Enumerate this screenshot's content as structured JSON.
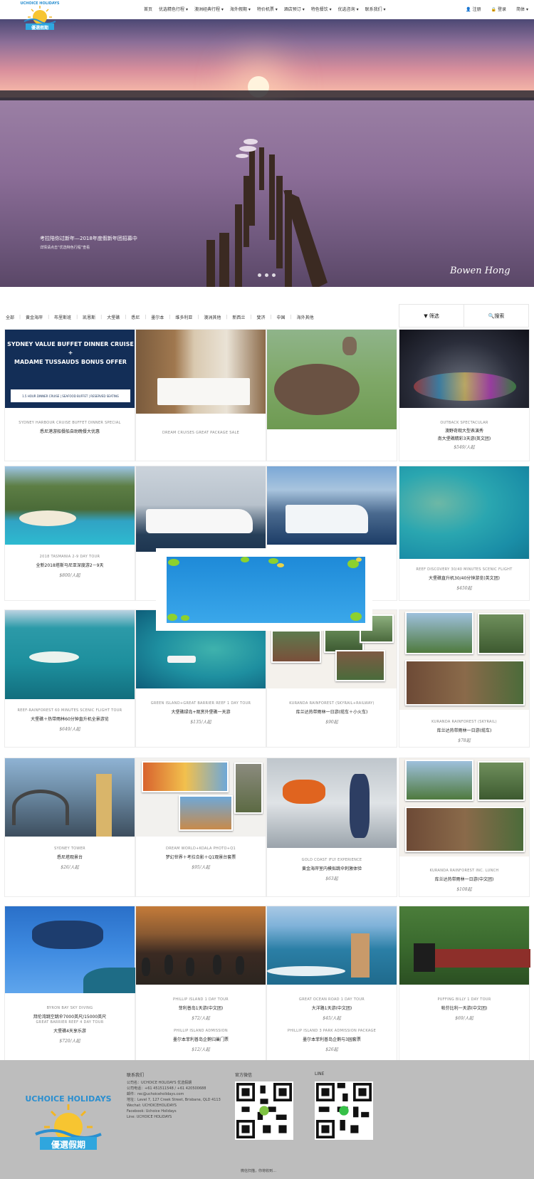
{
  "header": {
    "brand_top": "UCHOICE HOLIDAYS",
    "brand_cn": "優選假期",
    "nav": [
      "首页",
      "优选精色行程",
      "澳洲经典行程",
      "海外假期",
      "特价机票",
      "酒店预订",
      "特色餐饮",
      "优选咨询",
      "联系我们"
    ],
    "register": "注册",
    "login": "登录",
    "lang": "简体"
  },
  "hero": {
    "caption_line1": "考拉陪你过新年—2018年度假新年团招募中",
    "caption_line2": "详情请点击“优选特色行程”查看",
    "signature": "Bowen Hong",
    "slides": 3
  },
  "filter": {
    "categories": [
      "全部",
      "黄金海岸",
      "布里斯班",
      "凯恩斯",
      "大堡礁",
      "悉尼",
      "墨尔本",
      "维多利亚",
      "澳洲其他",
      "新西兰",
      "斐济",
      "中国",
      "海外其他"
    ],
    "tab_filter": "筛选",
    "tab_search": "搜索"
  },
  "cards": [
    {
      "en": "SYDNEY HARBOUR CRUISE BUFFET DINNER SPECIAL",
      "cn": "悉尼港游船餐船自助晚餐大优惠",
      "price": "",
      "img_title": "SYDNEY VALUE BUFFET DINNER CRUISE",
      "img_plus": "+",
      "img_sub": "MADAME TUSSAUDS BONUS OFFER",
      "img_tags": "1.5 HOUR DINNER CRUISE | SEAFOOD BUFFET | RESERVED SEATING"
    },
    {
      "en": "DREAM CRUISES GREAT PACKAGE SALE",
      "cn": "",
      "price": ""
    },
    {
      "en": "",
      "cn": "",
      "price": ""
    },
    {
      "en": "OUTBACK SPECTACULAR",
      "cn": "澳野奇观大型表演秀",
      "cn2": "南大堡礁精彩3天游(英文团)",
      "price": "$549/人起"
    },
    {
      "en": "2018 TASMANIA 2-9 DAY TOUR",
      "cn": "全新2018塔斯马尼亚深度游2－9天",
      "price": "$800/人起"
    },
    {
      "en": "",
      "cn": "",
      "price": ""
    },
    {
      "en": "",
      "cn": "",
      "price": ""
    },
    {
      "en": "REEF DISCOVERY 30/40 MINUTES SCENIC FLIGHT",
      "cn": "大堡礁直升机30/40分钟游览(英文团)",
      "price": "$450起"
    },
    {
      "en": "REEF-RAINFOREST 60 MINUTES SCENIC FLIGHT TOUR",
      "cn": "大堡礁＋热带雨林60分钟直升机全景游览",
      "price": "$649/人起"
    },
    {
      "en": "GREEN ISLAND+GREAT BARRIER REEF 1 DAY TOUR",
      "cn": "大堡礁绿岛+观赏外堡礁一天游",
      "price": "$135/人起"
    },
    {
      "en": "KURANDA RAINFOREST (SKYRAIL+RAILWAY)",
      "cn": "库兰达热带雨林一日游(缆车＋小火车)",
      "price": "$90起"
    },
    {
      "en": "KURANDA RAINFOREST (SKYRAIL)",
      "cn": "库兰达热带雨林一日游(缆车)",
      "price": "$78起"
    },
    {
      "en": "SYDNEY TOWER",
      "cn": "悉尼塔观景台",
      "price": "$26/人起"
    },
    {
      "en": "DREAM WORLD+KOALA PHOTO+Q1",
      "cn": "梦幻世界＋考拉合影＋Q1观景台套票",
      "price": "$95/人起"
    },
    {
      "en": "GOLD COAST IFLY EXPERIENCE",
      "cn": "黄金海岸室内模拟跳伞刺激体验",
      "price": "$63起"
    },
    {
      "en": "KURANDA RAINFOREST INC. LUNCH",
      "cn": "库兰达热带雨林一日游(中文团)",
      "price": "$108起"
    },
    {
      "en": "BYRON BAY SKY DIVING",
      "cn": "拜伦湾跳空跳伞7000英尺/15000英尺",
      "en2": "GREAT BARRIER REEF 4 DAY TOUR",
      "cn2": "大堡礁4天享乐游",
      "price": "$720/人起"
    },
    {
      "en": "PHILLIP ISLAND 1 DAY TOUR",
      "cn": "菲利普岛1天游(中文团)",
      "price": "$72/人起",
      "en2": "PHILLIP ISLAND ADMISSION",
      "cn2": "墨尔本菲利普岛企鹅归巢门票",
      "price2": "$12/人起"
    },
    {
      "en": "GREAT OCEAN ROAD 1 DAY TOUR",
      "cn": "大洋路1天游(中文团)",
      "price": "$45/人起",
      "en2": "PHILLIP ISLAND 3 PARK ADMISSION PACKAGE",
      "cn2": "墨尔本菲利普岛企鹅与3园套票",
      "price2": "$26起"
    },
    {
      "en": "PUFFING BILLY 1 DAY TOUR",
      "cn": "帕芬比利一天游(中文团)",
      "price": "$69/人起"
    }
  ],
  "footer": {
    "logo_en": "UCHOICE HOLIDAYS",
    "logo_cn": "優選假期",
    "contact_title": "联系我们",
    "contact_lines": [
      "公司名：UCHOICE HOLIDAYS 优选假期",
      "公司电话：+61 451511548 / +61 420500688",
      "邮件：rec@uchoiceholidays.com",
      "地址：Level 7, 127 Creek Street, Brisbane, QLD 4113",
      "Wechat: UCHOICEHOLIDAYS",
      "Facebook: Uchoice Holidays",
      "Line: UCHOICE HOLIDAYS"
    ],
    "wechat_title": "官方微信",
    "wechat_note": "微信扫描，你将收到…",
    "line_title": "LINE"
  },
  "colors": {
    "footer_bg": "#bdbdbd",
    "brand_yellow": "#f3b623",
    "brand_blue": "#2a8fd0"
  }
}
